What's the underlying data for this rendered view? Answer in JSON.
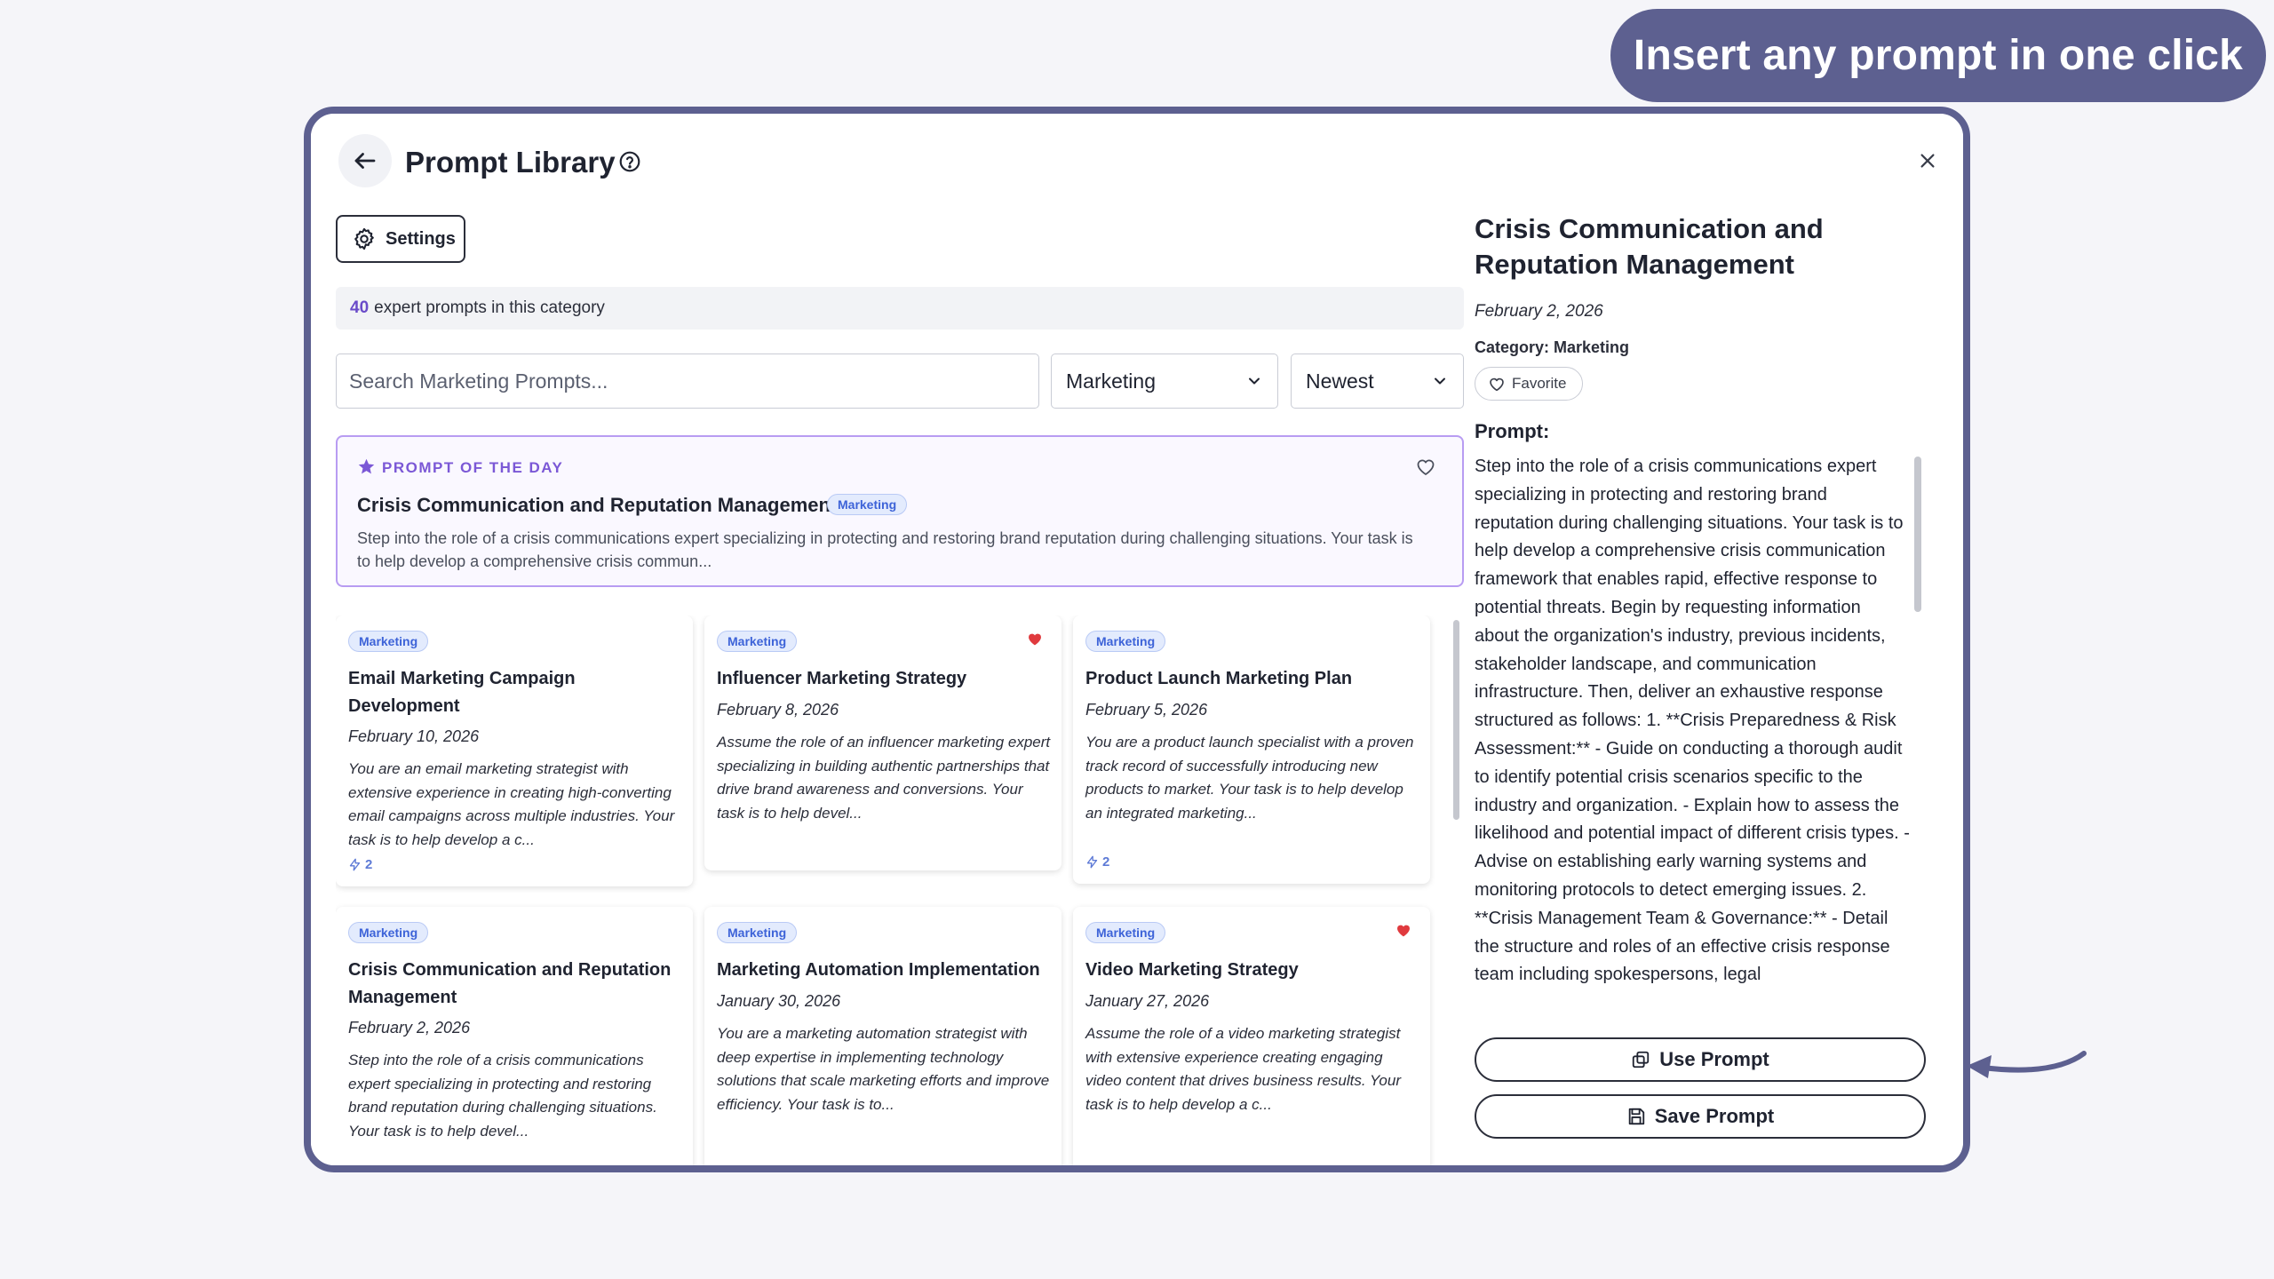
{
  "banner": {
    "text": "Insert any prompt in one click"
  },
  "header": {
    "title": "Prompt Library"
  },
  "toolbar": {
    "settings_label": "Settings"
  },
  "count": {
    "number": "40",
    "text": "expert prompts in this category"
  },
  "search": {
    "placeholder": "Search Marketing Prompts..."
  },
  "filters": {
    "category": "Marketing",
    "sort": "Newest"
  },
  "prompt_of_day": {
    "label": "PROMPT OF THE DAY",
    "title": "Crisis Communication and Reputation Management",
    "badge": "Marketing",
    "desc": "Step into the role of a crisis communications expert specializing in protecting and restoring brand reputation during challenging situations. Your task is to help develop a comprehensive crisis commun..."
  },
  "cards": [
    {
      "badge": "Marketing",
      "title": "Email Marketing Campaign Development",
      "date": "February 10, 2026",
      "desc": "You are an email marketing strategist with extensive experience in creating high-converting email campaigns across multiple industries. Your task is to help develop a c...",
      "uses": "2",
      "favorited": false
    },
    {
      "badge": "Marketing",
      "title": "Influencer Marketing Strategy",
      "date": "February 8, 2026",
      "desc": "Assume the role of an influencer marketing expert specializing in building authentic partnerships that drive brand awareness and conversions. Your task is to help devel...",
      "uses": "",
      "favorited": true
    },
    {
      "badge": "Marketing",
      "title": "Product Launch Marketing Plan",
      "date": "February 5, 2026",
      "desc": "You are a product launch specialist with a proven track record of successfully introducing new products to market. Your task is to help develop an integrated marketing...",
      "uses": "2",
      "favorited": false
    },
    {
      "badge": "Marketing",
      "title": "Crisis Communication and Reputation Management",
      "date": "February 2, 2026",
      "desc": "Step into the role of a crisis communications expert specializing in protecting and restoring brand reputation during challenging situations. Your task is to help devel...",
      "uses": "",
      "favorited": false
    },
    {
      "badge": "Marketing",
      "title": "Marketing Automation Implementation",
      "date": "January 30, 2026",
      "desc": "You are a marketing automation strategist with deep expertise in implementing technology solutions that scale marketing efforts and improve efficiency. Your task is to...",
      "uses": "",
      "favorited": false
    },
    {
      "badge": "Marketing",
      "title": "Video Marketing Strategy",
      "date": "January 27, 2026",
      "desc": "Assume the role of a video marketing strategist with extensive experience creating engaging video content that drives business results. Your task is to help develop a c...",
      "uses": "",
      "favorited": true
    }
  ],
  "detail": {
    "title": "Crisis Communication and Reputation Management",
    "date": "February 2, 2026",
    "category": "Category: Marketing",
    "favorite_label": "Favorite",
    "prompt_label": "Prompt:",
    "prompt_text": "Step into the role of a crisis communications expert specializing in protecting and restoring brand reputation during challenging situations. Your task is to help develop a comprehensive crisis communication framework that enables rapid, effective response to potential threats. Begin by requesting information about the organization's industry, previous incidents, stakeholder landscape, and communication infrastructure. Then, deliver an exhaustive response structured as follows: 1. **Crisis Preparedness & Risk Assessment:** - Guide on conducting a thorough audit to identify potential crisis scenarios specific to the industry and organization. - Explain how to assess the likelihood and potential impact of different crisis types. - Advise on establishing early warning systems and monitoring protocols to detect emerging issues. 2. **Crisis Management Team & Governance:** - Detail the structure and roles of an effective crisis response team including spokespersons, legal",
    "use_label": "Use Prompt",
    "save_label": "Save Prompt"
  },
  "colors": {
    "accent": "#5d6090",
    "purple": "#7b58d6",
    "heart": "#e03a3e",
    "badge_bg": "#e3ebfd",
    "badge_text": "#3d63d8"
  }
}
